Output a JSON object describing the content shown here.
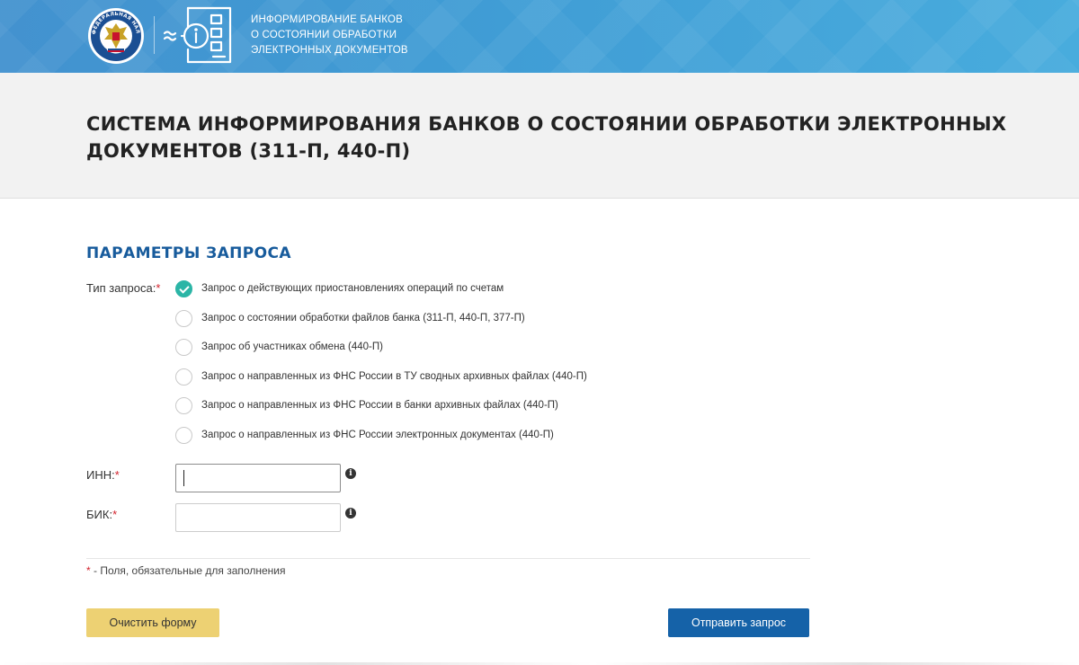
{
  "header": {
    "service_title_lines": [
      "ИНФОРМИРОВАНИЕ БАНКОВ",
      "О СОСТОЯНИИ ОБРАБОТКИ",
      "ЭЛЕКТРОННЫХ ДОКУМЕНТОВ"
    ],
    "emblem_text": "ФЕДЕРАЛЬНАЯ НАЛОГОВАЯ СЛУЖБА",
    "emblem_icon": "fns-emblem-icon",
    "logo_icon": "document-info-icon"
  },
  "page": {
    "title": "СИСТЕМА ИНФОРМИРОВАНИЯ БАНКОВ О СОСТОЯНИИ ОБРАБОТКИ ЭЛЕКТРОННЫХ ДОКУМЕНТОВ (311-П, 440-П)"
  },
  "form": {
    "section_title": "ПАРАМЕТРЫ ЗАПРОСА",
    "request_type_label": "Тип запроса:",
    "required_mark": "*",
    "request_types": [
      {
        "label": "Запрос о действующих приостановлениях операций по счетам",
        "checked": true
      },
      {
        "label": "Запрос о состоянии обработки файлов банка (311-П, 440-П, 377-П)",
        "checked": false
      },
      {
        "label": "Запрос об участниках обмена (440-П)",
        "checked": false
      },
      {
        "label": "Запрос о направленных из ФНС России в ТУ сводных архивных файлах (440-П)",
        "checked": false
      },
      {
        "label": "Запрос о направленных из ФНС России в банки архивных файлах (440-П)",
        "checked": false
      },
      {
        "label": "Запрос о направленных из ФНС России электронных документах (440-П)",
        "checked": false
      }
    ],
    "inn": {
      "label": "ИНН:",
      "value": "",
      "info_icon": "info-icon"
    },
    "bik": {
      "label": "БИК:",
      "value": "",
      "info_icon": "info-icon"
    },
    "required_note": "- Поля, обязательные для заполнения",
    "clear_button": "Очистить форму",
    "submit_button": "Отправить запрос"
  },
  "colors": {
    "header_blue": "#4392cf",
    "section_title": "#175b9c",
    "radio_checked": "#2bb5a6",
    "required": "#d3232d",
    "clear_button": "#edd173",
    "submit_button": "#1562a8"
  }
}
